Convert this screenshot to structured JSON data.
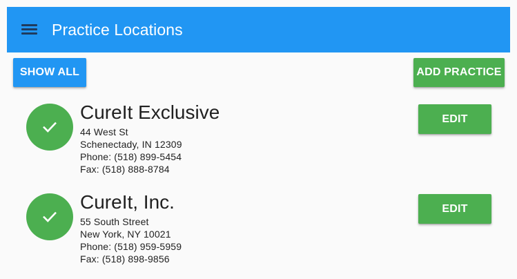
{
  "app_bar": {
    "title": "Practice Locations",
    "menu_icon": "hamburger-menu-icon",
    "color": "#2196f3"
  },
  "toolbar": {
    "show_all_label": "SHOW ALL",
    "add_practice_label": "ADD PRACTICE"
  },
  "locations": [
    {
      "name": "CureIt Exclusive",
      "address1": "44 West St",
      "address2": "Schenectady, IN 12309",
      "phone": "Phone: (518) 899-5454",
      "fax": "Fax: (518) 888-8784",
      "status_icon": "check-icon",
      "edit_label": "EDIT"
    },
    {
      "name": "CureIt, Inc.",
      "address1": "55 South Street",
      "address2": "New York, NY 10021",
      "phone": "Phone: (518) 959-5959",
      "fax": "Fax: (518) 898-9856",
      "status_icon": "check-icon",
      "edit_label": "EDIT"
    }
  ],
  "colors": {
    "primary": "#2196f3",
    "accent": "#4caf50",
    "background": "#fafafa"
  }
}
